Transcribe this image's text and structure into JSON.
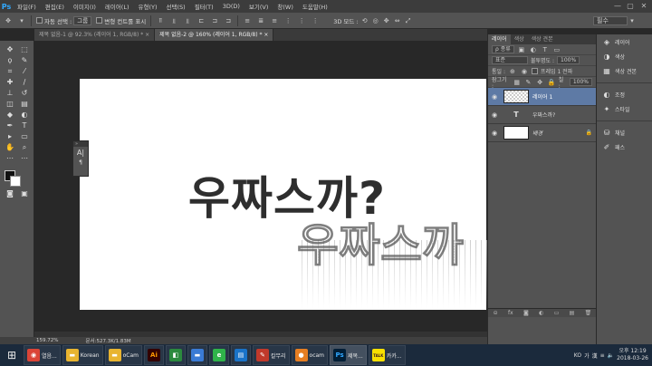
{
  "menubar": {
    "logo": "Ps",
    "items": [
      "파일(F)",
      "편집(E)",
      "이미지(I)",
      "레이어(L)",
      "유형(Y)",
      "선택(S)",
      "필터(T)",
      "3D(D)",
      "보기(V)",
      "창(W)",
      "도움말(H)"
    ],
    "controls": [
      "—",
      "▢",
      "✕"
    ]
  },
  "options": {
    "auto_select_label": "자동 선택 :",
    "auto_select_value": "그룹",
    "transform_label": "변형 컨트롤 표시",
    "mode_3d": "3D 모드 :",
    "workspace": "필수"
  },
  "tabs": [
    {
      "label": "제목 없음-1 @ 92.3% (레이어 1, RGB/8) *  ×"
    },
    {
      "label": "제목 없음-2 @ 160% (레이어 1, RGB/8) *  ×"
    }
  ],
  "canvas": {
    "headline": "우짜스까?",
    "ghost": "우짜스까"
  },
  "char_panel": {
    "icon_a": "A|",
    "icon_p": "¶"
  },
  "status": {
    "zoom": "159.72%",
    "doc": "문서:527.3K/1.83M"
  },
  "layers_panel": {
    "tabs": [
      "레이어",
      "색상",
      "색상 견본"
    ],
    "kind": "ρ 종류",
    "blend": "표준",
    "opacity_label": "불투명도 :",
    "opacity": "100%",
    "lock_label": "잠그기 :",
    "fill_label": "칠 :",
    "fill": "100%",
    "unify_label": "통일 :",
    "propagate_label": "프레임 1 전파",
    "layers": [
      {
        "name": "레이어 1",
        "selected": true,
        "thumb": "checker"
      },
      {
        "name": "우짜스까?",
        "selected": false,
        "thumb": "text",
        "thumb_text": "T"
      },
      {
        "name": "배경",
        "selected": false,
        "thumb": "white",
        "italic": true,
        "lock": "🔒"
      }
    ],
    "footer_icons": [
      "⊝",
      "fx",
      "◙",
      "◐",
      "▭",
      "▤",
      "🗑"
    ]
  },
  "dock": [
    {
      "icon": "◈",
      "label": "레이어"
    },
    {
      "icon": "◑",
      "label": "색상"
    },
    {
      "icon": "▦",
      "label": "색상 견본"
    },
    {
      "icon": "◐",
      "label": "조정"
    },
    {
      "icon": "✦",
      "label": "스타일"
    },
    {
      "icon": "⛁",
      "label": "채널"
    },
    {
      "icon": "✐",
      "label": "패스"
    }
  ],
  "taskbar": {
    "items": [
      {
        "label": "열음...",
        "color": "#db4437",
        "icon": "◉"
      },
      {
        "label": "Korean",
        "color": "#e8b430",
        "icon": "▬"
      },
      {
        "label": "oCam",
        "color": "#e8b430",
        "icon": "▬"
      },
      {
        "label": "Ai",
        "color": "#330000",
        "icon": "Ai"
      },
      {
        "label": "",
        "color": "#2b8a3e",
        "icon": "◧"
      },
      {
        "label": "",
        "color": "#3a7bd5",
        "icon": "▬"
      },
      {
        "label": "",
        "color": "#2fb34a",
        "icon": "e"
      },
      {
        "label": "",
        "color": "#1a73c8",
        "icon": "▤"
      },
      {
        "label": "칼무리",
        "color": "#c0392b",
        "icon": "✎"
      },
      {
        "label": "ocam",
        "color": "#e67e22",
        "icon": "●"
      },
      {
        "label": "제목...",
        "color": "#001e36",
        "icon": "Ps"
      },
      {
        "label": "카카...",
        "color": "#f9e000",
        "icon": "TALK"
      }
    ],
    "tray": [
      "KO",
      "가",
      "漢",
      "≡"
    ],
    "time": "오후 12:19",
    "date": "2018-03-26"
  }
}
